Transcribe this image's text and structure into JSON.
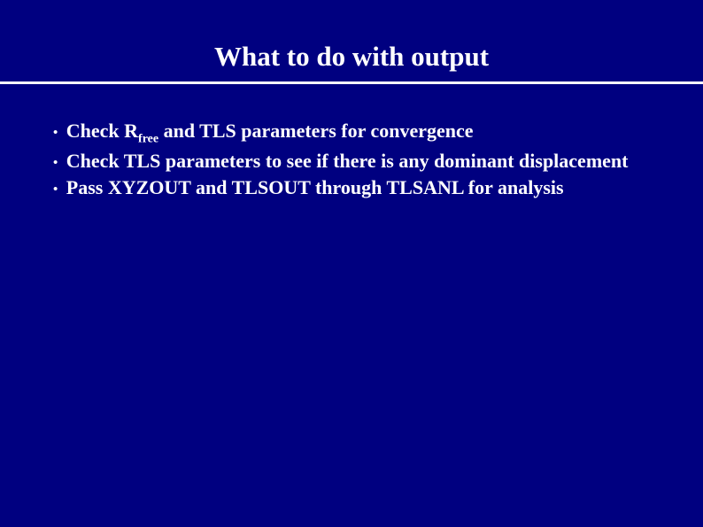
{
  "slide": {
    "title": "What to do with output",
    "bullets": {
      "b1_pre": "Check R",
      "b1_sub": "free",
      "b1_post": " and TLS parameters for convergence",
      "b2": "Check TLS parameters to see if there is any dominant displacement",
      "b3": "Pass XYZOUT and TLSOUT through TLSANL for analysis"
    }
  }
}
